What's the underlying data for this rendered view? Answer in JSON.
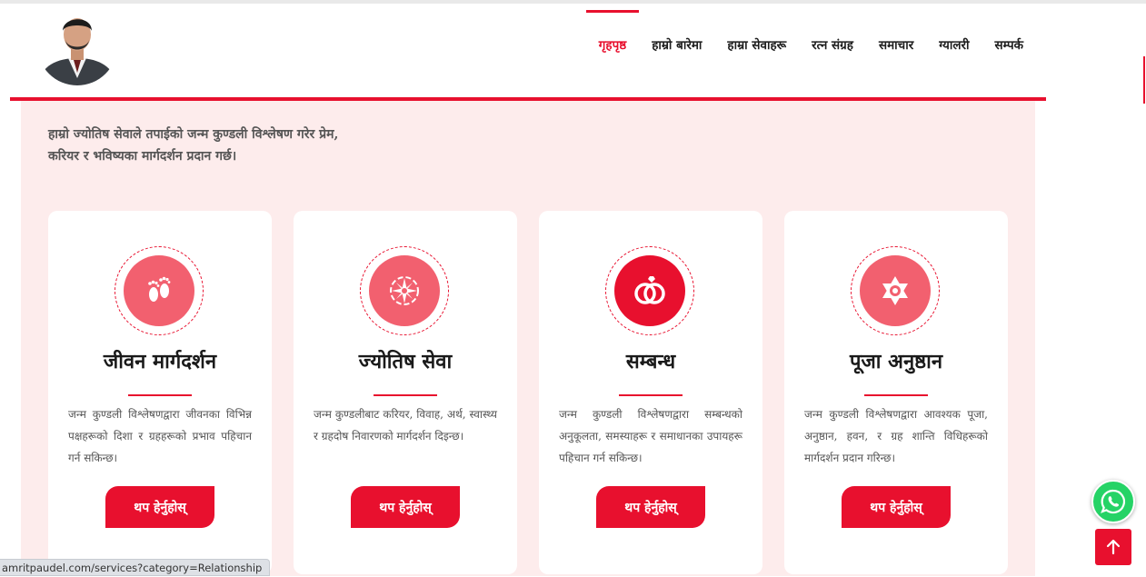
{
  "nav": {
    "items": [
      {
        "label": "गृहपृष्ठ",
        "active": true
      },
      {
        "label": "हाम्रो बारेमा",
        "active": false
      },
      {
        "label": "हाम्रा सेवाहरू",
        "active": false
      },
      {
        "label": "रत्न संग्रह",
        "active": false
      },
      {
        "label": "समाचार",
        "active": false
      },
      {
        "label": "ग्यालरी",
        "active": false
      },
      {
        "label": "सम्पर्क",
        "active": false
      }
    ]
  },
  "intro": {
    "line1": "हाम्रो ज्योतिष सेवाले तपाईको जन्म कुण्डली विश्लेषण गरेर प्रेम,",
    "line2": "करियर र भविष्यका मार्गदर्शन प्रदान गर्छ।"
  },
  "services": [
    {
      "icon": "baby-feet-icon",
      "title": "जीवन मार्गदर्शन",
      "desc": "जन्म कुण्डली विश्लेषणद्वारा जीवनका विभिन्न पक्षहरूको दिशा र ग्रहहरूको प्रभाव पहिचान गर्न सकिन्छ।",
      "button": "थप हेर्नुहोस्"
    },
    {
      "icon": "compass-icon",
      "title": "ज्योतिष सेवा",
      "desc": "जन्म कुण्डलीबाट करियर, विवाह, अर्थ, स्वास्थ्य र ग्रहदोष निवारणको मार्गदर्शन दिइन्छ।",
      "button": "थप हेर्नुहोस्"
    },
    {
      "icon": "wedding-rings-icon",
      "title": "सम्बन्ध",
      "desc": "जन्म कुण्डली विश्लेषणद्वारा सम्बन्धको अनुकूलता, समस्याहरू र समाधानका उपायहरू पहिचान गर्न सकिन्छ।",
      "button": "थप हेर्नुहोस्"
    },
    {
      "icon": "hexagram-icon",
      "title": "पूजा अनुष्ठान",
      "desc": "जन्म कुण्डली विश्लेषणद्वारा आवश्यक पूजा, अनुष्ठान, हवन, र ग्रह शान्ति विधिहरूको मार्गदर्शन प्रदान गरिन्छ।",
      "button": "थप हेर्नुहोस्"
    }
  ],
  "status_bar": {
    "url": "amritpaudel.com/services?category=Relationship"
  },
  "colors": {
    "accent": "#e8102e",
    "icon_disc": "#f2606f",
    "section_bg": "#fdecec",
    "whatsapp": "#25d366"
  },
  "floating": {
    "whatsapp_icon": "whatsapp-icon",
    "back_to_top_icon": "arrow-up-icon"
  }
}
